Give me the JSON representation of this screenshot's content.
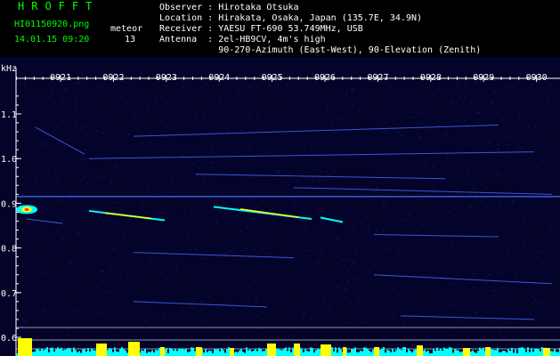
{
  "header": {
    "app_title": "HROFFT",
    "filename": "HI01150920.png",
    "timestamp": "14.01.15 09:20",
    "meteor_label": "meteor",
    "meteor_count": "13"
  },
  "info_lines": [
    "Observer : Hirotaka Otsuka",
    "Location : Hirakata, Osaka, Japan (135.7E, 34.9N)",
    "Receiver : YAESU FT-690 53.749MHz, USB",
    "Antenna  : 2el-HB9CV, 4m's high",
    "           90-270-Azimuth (East-West), 90-Elevation (Zenith)"
  ],
  "chart_data": {
    "type": "heatmap",
    "ylabel": "kHz",
    "y_ticks": [
      "1.1",
      "1.0",
      "0.9",
      "0.8",
      "0.7",
      "0.6"
    ],
    "x_ticks": [
      "0921",
      "0922",
      "0923",
      "0924",
      "0925",
      "0926",
      "0927",
      "0928",
      "0929",
      "0930"
    ],
    "ylim": [
      0.6,
      1.1
    ],
    "colors": {
      "background": "#04042a",
      "noise": "#1a1a9a",
      "axis": "#ffffff",
      "trace": "#4a6aff",
      "echo": "#00ffff",
      "strong_echo": "#ffff00",
      "bar_fill": "#00ffff",
      "bar_peak": "#ffff00"
    }
  }
}
